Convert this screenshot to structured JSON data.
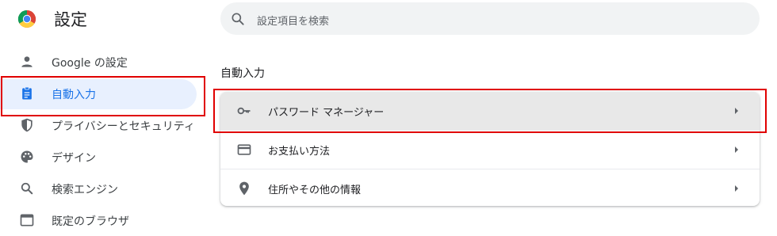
{
  "header": {
    "title": "設定",
    "logo_icon": "chrome-logo-icon"
  },
  "search": {
    "placeholder": "設定項目を検索",
    "icon": "search-icon"
  },
  "sidebar": {
    "items": [
      {
        "label": "Google の設定",
        "icon": "person-icon",
        "active": false
      },
      {
        "label": "自動入力",
        "icon": "clipboard-icon",
        "active": true
      },
      {
        "label": "プライバシーとセキュリティ",
        "icon": "shield-icon",
        "active": false
      },
      {
        "label": "デザイン",
        "icon": "palette-icon",
        "active": false
      },
      {
        "label": "検索エンジン",
        "icon": "search-icon",
        "active": false
      },
      {
        "label": "既定のブラウザ",
        "icon": "browser-window-icon",
        "active": false
      }
    ]
  },
  "main": {
    "section_title": "自動入力",
    "rows": [
      {
        "label": "パスワード マネージャー",
        "icon": "key-icon"
      },
      {
        "label": "お支払い方法",
        "icon": "credit-card-icon"
      },
      {
        "label": "住所やその他の情報",
        "icon": "location-pin-icon"
      }
    ]
  },
  "colors": {
    "accent": "#1a73e8",
    "active_bg": "#e8f0fe",
    "highlight_box": "#e00000"
  }
}
